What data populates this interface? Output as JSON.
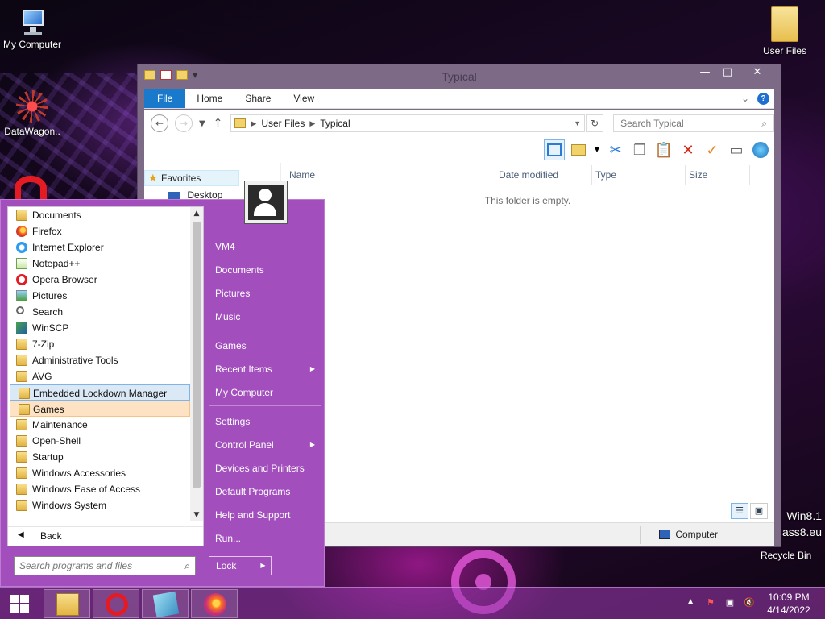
{
  "desktop": {
    "icons": [
      {
        "label": "My Computer"
      },
      {
        "label": "DataWagon.."
      },
      {
        "label": "User Files"
      }
    ],
    "recycle_bin": "Recycle Bin",
    "watermark": [
      "Win8.1",
      "ass8.eu"
    ]
  },
  "explorer": {
    "title": "Typical",
    "window_buttons": {
      "minimize": "—",
      "maximize": "□",
      "close": "✕"
    },
    "ribbon_tabs": [
      "File",
      "Home",
      "Share",
      "View"
    ],
    "address": {
      "root": "User Files",
      "current": "Typical"
    },
    "search_placeholder": "Search Typical",
    "nav_pane": {
      "favorites": "Favorites",
      "desktop": "Desktop"
    },
    "columns": [
      "Name",
      "Date modified",
      "Type",
      "Size"
    ],
    "empty_message": "This folder is empty.",
    "status": {
      "location": "Computer"
    }
  },
  "start_menu": {
    "programs": [
      {
        "label": "Documents",
        "icon": "folder"
      },
      {
        "label": "Firefox",
        "icon": "firefox"
      },
      {
        "label": "Internet Explorer",
        "icon": "ie"
      },
      {
        "label": "Notepad++",
        "icon": "notepad"
      },
      {
        "label": "Opera Browser",
        "icon": "opera"
      },
      {
        "label": "Pictures",
        "icon": "pictures"
      },
      {
        "label": "Search",
        "icon": "search"
      },
      {
        "label": "WinSCP",
        "icon": "winscp"
      },
      {
        "label": "7-Zip",
        "icon": "folder"
      },
      {
        "label": "Administrative Tools",
        "icon": "folder"
      },
      {
        "label": "AVG",
        "icon": "folder"
      },
      {
        "label": "Embedded Lockdown Manager",
        "icon": "folder"
      },
      {
        "label": "Games",
        "icon": "folder"
      },
      {
        "label": "Maintenance",
        "icon": "folder"
      },
      {
        "label": "Open-Shell",
        "icon": "folder"
      },
      {
        "label": "Startup",
        "icon": "folder"
      },
      {
        "label": "Windows Accessories",
        "icon": "folder"
      },
      {
        "label": "Windows Ease of Access",
        "icon": "folder"
      },
      {
        "label": "Windows System",
        "icon": "folder"
      }
    ],
    "back_label": "Back",
    "search_placeholder": "Search programs and files",
    "right_items": [
      {
        "label": "VM4",
        "submenu": false
      },
      {
        "label": "Documents",
        "submenu": false
      },
      {
        "label": "Pictures",
        "submenu": false
      },
      {
        "label": "Music",
        "submenu": false
      },
      {
        "label": "Games",
        "submenu": false
      },
      {
        "label": "Recent Items",
        "submenu": true
      },
      {
        "label": "My Computer",
        "submenu": false
      },
      {
        "label": "Settings",
        "submenu": false
      },
      {
        "label": "Control Panel",
        "submenu": true
      },
      {
        "label": "Devices and Printers",
        "submenu": false
      },
      {
        "label": "Default Programs",
        "submenu": false
      },
      {
        "label": "Help and Support",
        "submenu": false
      },
      {
        "label": "Run...",
        "submenu": false
      }
    ],
    "lock_label": "Lock"
  },
  "taskbar": {
    "apps": [
      "file-explorer",
      "opera",
      "notes",
      "firefox"
    ],
    "clock": {
      "time": "10:09 PM",
      "date": "4/14/2022"
    }
  }
}
